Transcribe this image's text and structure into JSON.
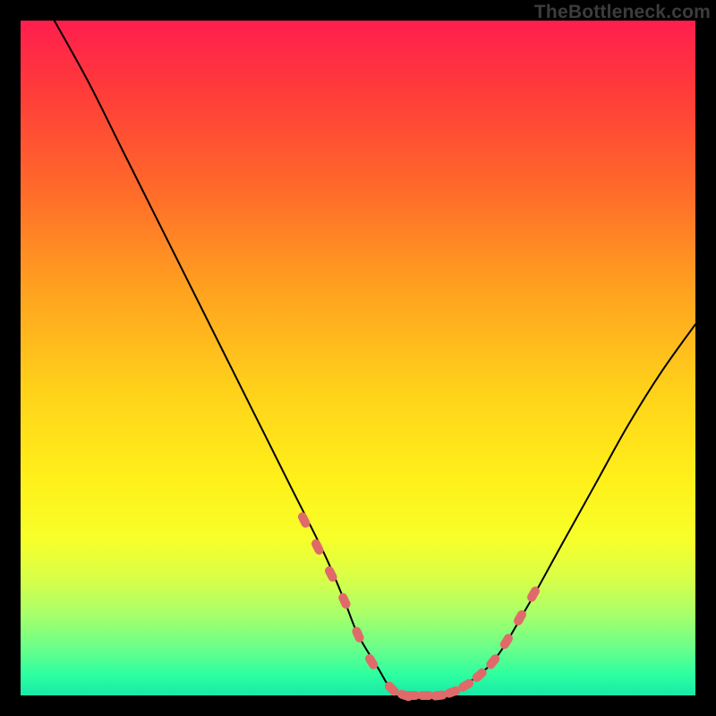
{
  "watermark": "TheBottleneck.com",
  "chart_data": {
    "type": "line",
    "title": "",
    "xlabel": "",
    "ylabel": "",
    "xlim": [
      0,
      100
    ],
    "ylim": [
      0,
      100
    ],
    "background_gradient": {
      "top": "#ff1e4e",
      "bottom": "#18e8a8",
      "meaning": "red high to green low"
    },
    "series": [
      {
        "name": "bottleneck-curve",
        "x": [
          5,
          10,
          15,
          20,
          25,
          30,
          35,
          40,
          45,
          48,
          50,
          53,
          55,
          58,
          60,
          63,
          65,
          70,
          75,
          80,
          85,
          90,
          95,
          100
        ],
        "y": [
          100,
          91,
          81,
          71,
          61,
          51,
          41,
          31,
          21,
          14,
          9,
          4,
          1,
          0,
          0,
          0,
          1,
          5,
          13,
          22,
          31,
          40,
          48,
          55
        ]
      }
    ],
    "markers": {
      "name": "highlighted-points",
      "color": "#e06a6a",
      "x": [
        42,
        44,
        46,
        48,
        50,
        52,
        55,
        57,
        58,
        60,
        62,
        64,
        66,
        68,
        70,
        72,
        74,
        76
      ],
      "y": [
        26,
        22,
        18,
        14,
        9,
        5,
        1,
        0,
        0,
        0,
        0,
        0.5,
        1.5,
        3,
        5,
        8,
        11.5,
        15
      ]
    }
  }
}
